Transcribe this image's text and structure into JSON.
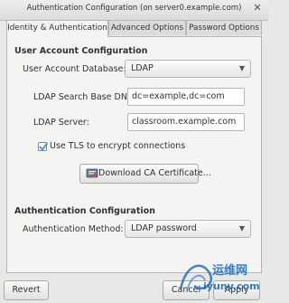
{
  "window": {
    "title": "Authentication Configuration (on server0.example.com)"
  },
  "tabs": [
    {
      "label": "Identity & Authentication",
      "active": true
    },
    {
      "label": "Advanced Options",
      "active": false
    },
    {
      "label": "Password Options",
      "active": false
    }
  ],
  "user_account": {
    "section_title": "User Account Configuration",
    "database_label": "User Account Database:",
    "database_value": "LDAP",
    "base_dn_label": "LDAP Search Base DN:",
    "base_dn_value": "dc=example,dc=com",
    "server_label": "LDAP Server:",
    "server_value": "classroom.example.com",
    "tls_label": "Use TLS to encrypt connections",
    "tls_checked": true,
    "download_label": "Download CA Certificate..."
  },
  "authentication": {
    "section_title": "Authentication Configuration",
    "method_label": "Authentication Method:",
    "method_value": "LDAP password"
  },
  "footer": {
    "revert_label": "Revert",
    "cancel_label": "Cancel",
    "apply_label": "Apply"
  },
  "watermark": {
    "text": "运维网",
    "url": "iyunv.com"
  },
  "colors": {
    "accent": "#4a90d9",
    "watermark": "#1f6fc5"
  }
}
